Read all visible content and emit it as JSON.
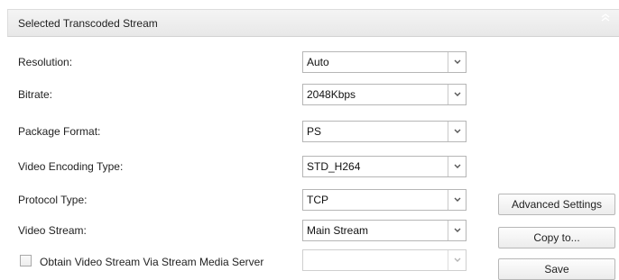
{
  "header": {
    "title": "Selected Transcoded Stream"
  },
  "fields": [
    {
      "label": "Resolution:",
      "value": "Auto"
    },
    {
      "label": "Bitrate:",
      "value": "2048Kbps"
    },
    {
      "label": "Package Format:",
      "value": "PS"
    },
    {
      "label": "Video Encoding Type:",
      "value": "STD_H264"
    },
    {
      "label": "Protocol Type:",
      "value": "TCP"
    },
    {
      "label": "Video Stream:",
      "value": "Main Stream"
    }
  ],
  "stream_media_server": {
    "checkbox_label": "Obtain Video Stream Via Stream Media Server",
    "checked": false,
    "value": ""
  },
  "buttons": {
    "advanced_settings": "Advanced Settings",
    "copy_to": "Copy to...",
    "save": "Save"
  },
  "icons": {
    "collapse": "double-chevron-up-icon",
    "dropdown": "chevron-down-icon"
  }
}
